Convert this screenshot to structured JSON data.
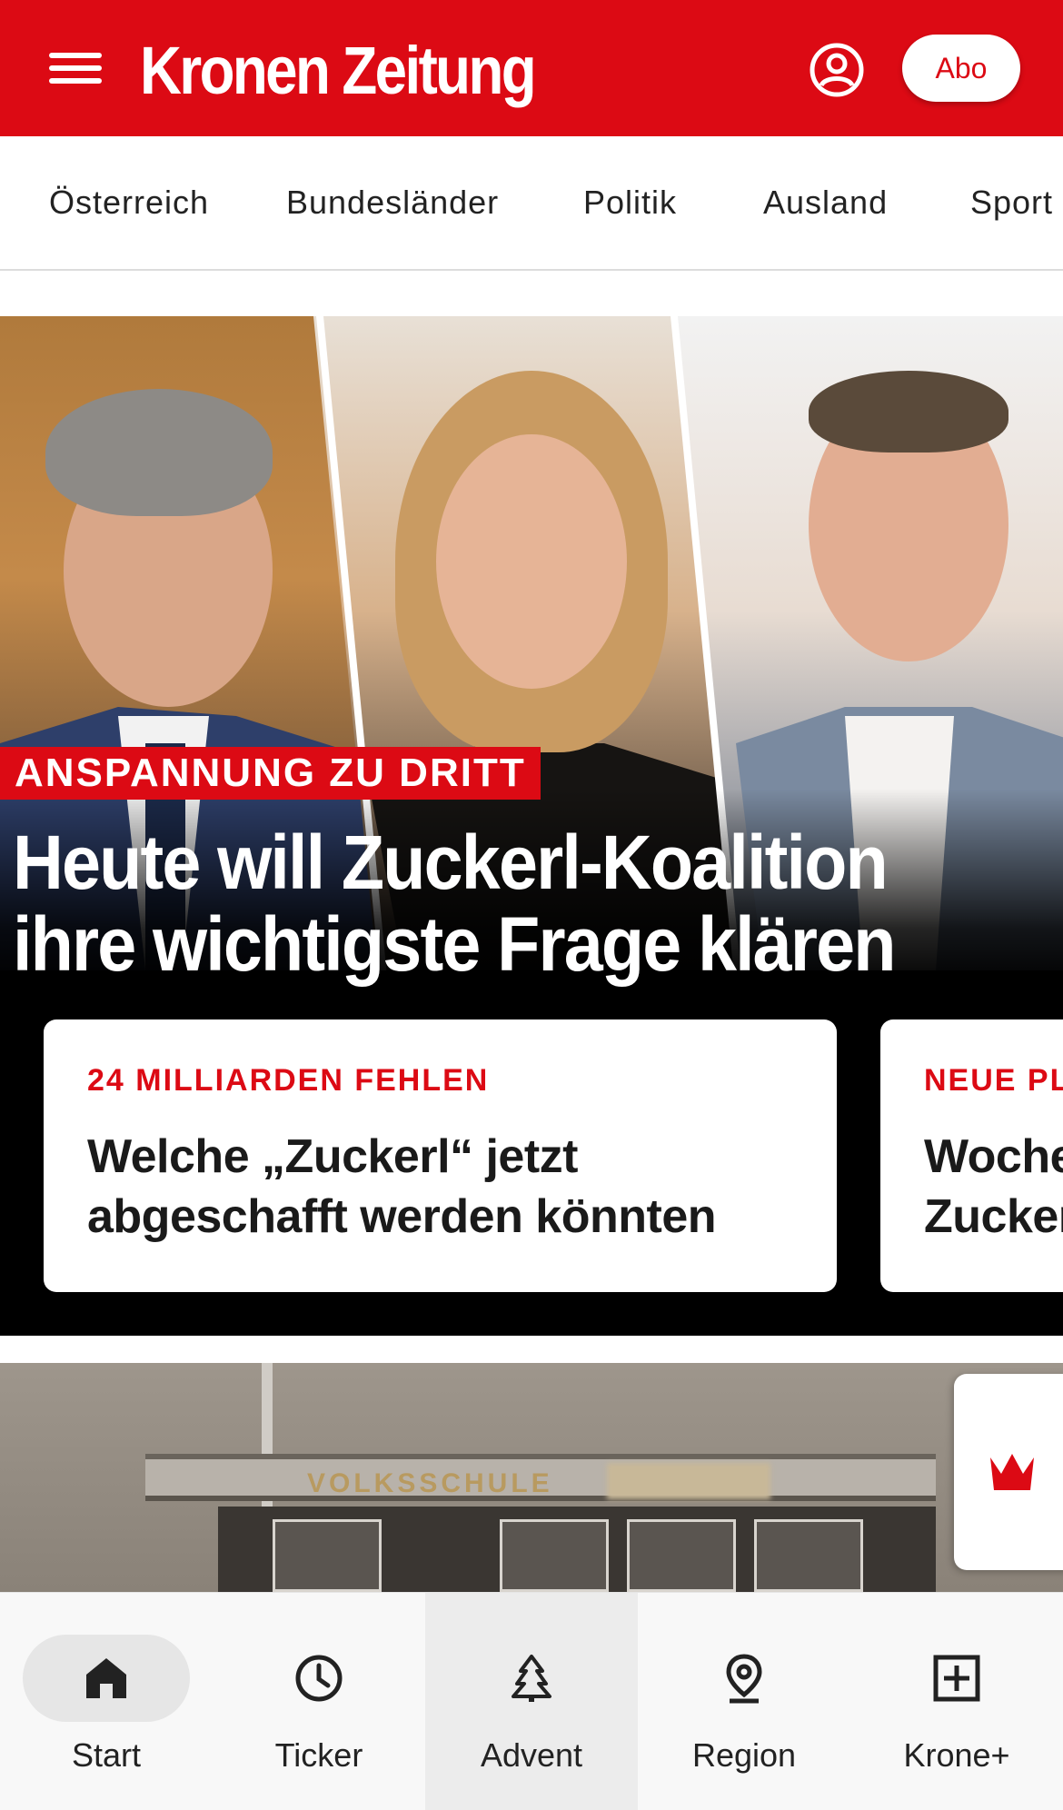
{
  "header": {
    "logo": "Kronen Zeitung",
    "abo_label": "Abo",
    "brand_color": "#dc0a14"
  },
  "nav": {
    "items": [
      "Österreich",
      "Bundesländer",
      "Politik",
      "Ausland",
      "Sport"
    ]
  },
  "hero": {
    "kicker": "ANSPANNUNG ZU DRITT",
    "headline": "Heute will Zuckerl-Koalition ihre wichtigste Frage klären"
  },
  "cards": [
    {
      "kicker": "24 MILLIARDEN FEHLEN",
      "title_line1": "Welche „Zuckerl“ jetzt",
      "title_line2": "abgeschafft werden könnten"
    },
    {
      "kicker": "NEUE PL",
      "title_line1": "Woche",
      "title_line2": "Zucker"
    }
  ],
  "article2": {
    "sign_text": "VOLKSSCHULE"
  },
  "bottom_nav": {
    "tabs": [
      {
        "label": "Start",
        "icon": "home-icon"
      },
      {
        "label": "Ticker",
        "icon": "clock-icon"
      },
      {
        "label": "Advent",
        "icon": "tree-icon"
      },
      {
        "label": "Region",
        "icon": "location-pin-icon"
      },
      {
        "label": "Krone+",
        "icon": "plus-box-icon"
      }
    ]
  }
}
